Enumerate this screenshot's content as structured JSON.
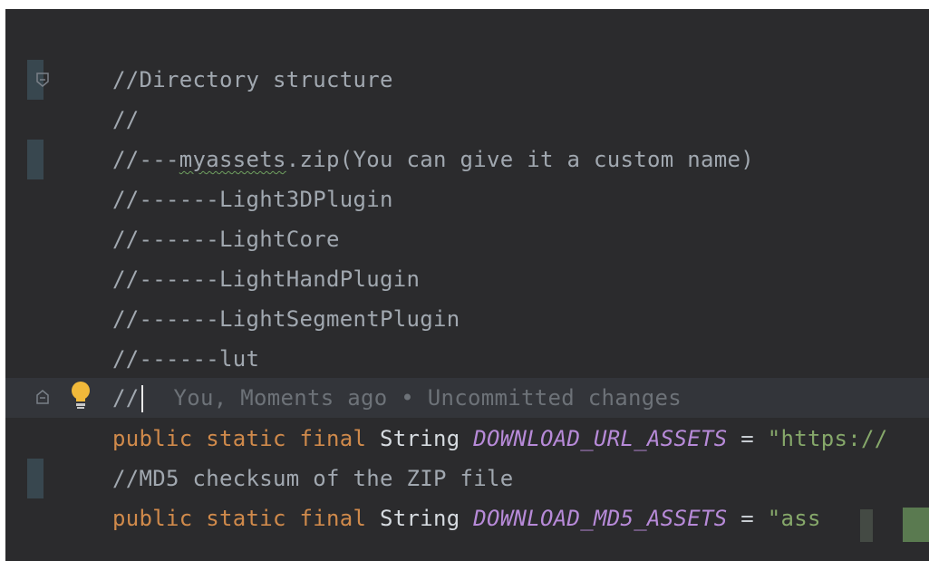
{
  "editor": {
    "lines": [
      {
        "text": "//Directory structure"
      },
      {
        "text": "//"
      },
      {
        "prefix": "//---",
        "squiggle_word": "myassets",
        "suffix": ".zip(You can give it a custom name)"
      },
      {
        "text": "//------Light3DPlugin"
      },
      {
        "text": "//------LightCore"
      },
      {
        "text": "//------LightHandPlugin"
      },
      {
        "text": "//------LightSegmentPlugin"
      },
      {
        "text": "//------lut"
      },
      {
        "text": "//",
        "blame": "You, Moments ago • Uncommitted changes"
      },
      {
        "kw1": "public",
        "kw2": "static",
        "kw3": "final",
        "type": "String",
        "const": "DOWNLOAD_URL_ASSETS",
        "op": "=",
        "str": "\"https://"
      },
      {
        "text": "//MD5 checksum of the ZIP file"
      },
      {
        "kw1": "public",
        "kw2": "static",
        "kw3": "final",
        "type": "String",
        "const": "DOWNLOAD_MD5_ASSETS",
        "op": "=",
        "str": "\"ass"
      }
    ],
    "icons": {
      "fold_top": "fold-collapse-icon",
      "fold_current": "fold-collapse-icon",
      "intention": "lightbulb-icon"
    },
    "colors": {
      "background": "#2b2b2d",
      "comment": "#a1a8b0",
      "keyword": "#d08a4b",
      "constant": "#b78ad8",
      "string": "#86a86a",
      "gutter_mark": "#38474f"
    }
  }
}
